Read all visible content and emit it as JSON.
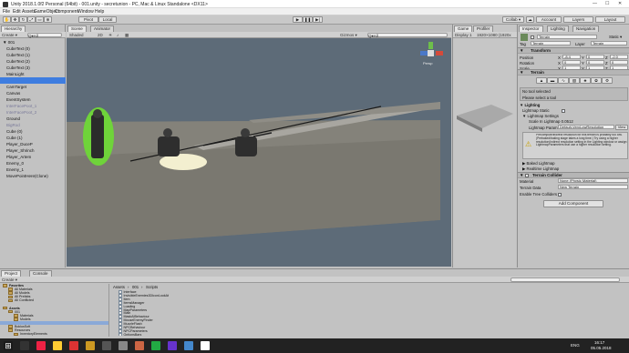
{
  "window": {
    "title": "Unity 2018.1.0f2 Personal (64bit) - 001.unity - secretunion - PC, Mac & Linux Standalone <DX11>"
  },
  "menu": [
    "File",
    "Edit",
    "Assets",
    "GameObject",
    "Component",
    "Window",
    "Help"
  ],
  "toolbar": {
    "pivot": "Pivot",
    "local": "Local",
    "collab": "Collab ▾",
    "account": "Account",
    "layers": "Layers",
    "layout": "Layout"
  },
  "hierarchy": {
    "tab": "Hierarchy",
    "create": "Create ▾",
    "search_placeholder": "Q▾All",
    "items": [
      {
        "label": "001",
        "indent": 0
      },
      {
        "label": "CubeText (0)",
        "indent": 2
      },
      {
        "label": "CubeText (1)",
        "indent": 2
      },
      {
        "label": "CubeText (2)",
        "indent": 2
      },
      {
        "label": "CubeText (3)",
        "indent": 2
      },
      {
        "label": "MainLight",
        "indent": 2
      },
      {
        "label": "",
        "indent": 2
      },
      {
        "label": "CamTarget",
        "indent": 2
      },
      {
        "label": "Canvas",
        "indent": 2
      },
      {
        "label": "EventSystem",
        "indent": 2
      },
      {
        "label": "InterFacePoot_1",
        "indent": 2,
        "dim": true
      },
      {
        "label": "InterFacePoot_2",
        "indent": 2,
        "dim": true
      },
      {
        "label": "Ground",
        "indent": 2
      },
      {
        "label": "BigRod",
        "indent": 2,
        "dim": true
      },
      {
        "label": "Cube (0)",
        "indent": 2
      },
      {
        "label": "Cube (1)",
        "indent": 2
      },
      {
        "label": "Player_DuceP",
        "indent": 2
      },
      {
        "label": "Player_Shrinch",
        "indent": 2
      },
      {
        "label": "Player_Artem",
        "indent": 2
      },
      {
        "label": "Enemy_0",
        "indent": 2
      },
      {
        "label": "Enemy_1",
        "indent": 2
      },
      {
        "label": "MovePointHere(Clone)",
        "indent": 2
      }
    ],
    "selected_index": 6
  },
  "scene": {
    "tabs": [
      "Scene",
      "Animator"
    ],
    "shaded": "Shaded",
    "mode_2d": "2D",
    "gizmos": "Gizmos ▾",
    "search_placeholder": "Q▾All",
    "persp": "Persp"
  },
  "game": {
    "tabs": [
      "Game",
      "Profiler"
    ],
    "display": "Display 1",
    "resolution": "1920×1080 (1920x"
  },
  "inspector": {
    "tabs": [
      "Inspector",
      "Lighting",
      "Navigation"
    ],
    "object_name": "Terrain",
    "static": "Static ▾",
    "tag_label": "Tag",
    "tag": "Terrain",
    "layer_label": "Layer",
    "layer": "Terrain",
    "transform": {
      "title": "Transform",
      "rows": [
        {
          "label": "Position",
          "x": "-8.4",
          "y": "0",
          "z": "-2.0"
        },
        {
          "label": "Rotation",
          "x": "0",
          "y": "0",
          "z": "0"
        },
        {
          "label": "Scale",
          "x": "1",
          "y": "1",
          "z": "1"
        }
      ]
    },
    "terrain": {
      "title": "Terrain",
      "no_tool": "No tool selected",
      "please": "Please select a tool",
      "lighting": "Lighting",
      "lightmap_static": "Lightmap Static",
      "lightmap_settings": "Lightmap Settings",
      "scale_label": "Scale In Lightmap",
      "scale_value": "0.0512",
      "params_label": "Lightmap Param",
      "params_value": "Default-VeryLowResolution",
      "view_label": "View",
      "warning": "Precompute/indirect resolution for this terrain is probably too low. (Prebaked/baking stage takes a long time.) Try using a higher resolution/Indirect resolution setting in the Lighting window or assign LightmapParameters that use a higher resolution setting.",
      "baked": "Baked Lightmap",
      "realtime": "Realtime Lightmap"
    },
    "collider": {
      "title": "Terrain Collider",
      "material_label": "Material",
      "material_value": "None (Physic Material)",
      "data_label": "Terrain Data",
      "data_value": "New Terrain",
      "trees_label": "Enable Tree Colliders"
    },
    "add_component": "Add Component"
  },
  "project": {
    "tabs": [
      "Project",
      "Console"
    ],
    "create": "Create ▾",
    "tree": [
      {
        "label": "Favorites",
        "indent": 0,
        "bold": true
      },
      {
        "label": "All Materials",
        "indent": 2
      },
      {
        "label": "All Models",
        "indent": 2
      },
      {
        "label": "All Prefabs",
        "indent": 2
      },
      {
        "label": "All Conflicted",
        "indent": 2
      },
      {
        "label": "",
        "indent": 0
      },
      {
        "label": "Assets",
        "indent": 0,
        "bold": true
      },
      {
        "label": "001",
        "indent": 2
      },
      {
        "label": "Materials",
        "indent": 4
      },
      {
        "label": "Models",
        "indent": 4
      },
      {
        "label": "",
        "indent": 4,
        "sel": true
      },
      {
        "label": "BoklusSoft",
        "indent": 2
      },
      {
        "label": "Resources",
        "indent": 2
      },
      {
        "label": "InventoryElements",
        "indent": 4
      }
    ],
    "breadcrumb": [
      "Assets",
      "001",
      "Scripts"
    ],
    "files": [
      "Interface",
      "InvisibleEnemies3DIconLookAt",
      "Item",
      "ItemsManager",
      "Loading",
      "MapParameters",
      "Main",
      "MaskAIBehaviour",
      "MouseEnemyFinder",
      "MuzzleFlash",
      "NPCBehaviour",
      "NPCParameters",
      "OptionsBars"
    ]
  },
  "taskbar": {
    "lang": "ENG",
    "time": "16:17",
    "date": "05.05.2018"
  },
  "colors": {
    "selection": "#3e7de0",
    "ground": "#7b7a72",
    "sky": "#5d6b78",
    "highlight": "#6fd33a"
  }
}
